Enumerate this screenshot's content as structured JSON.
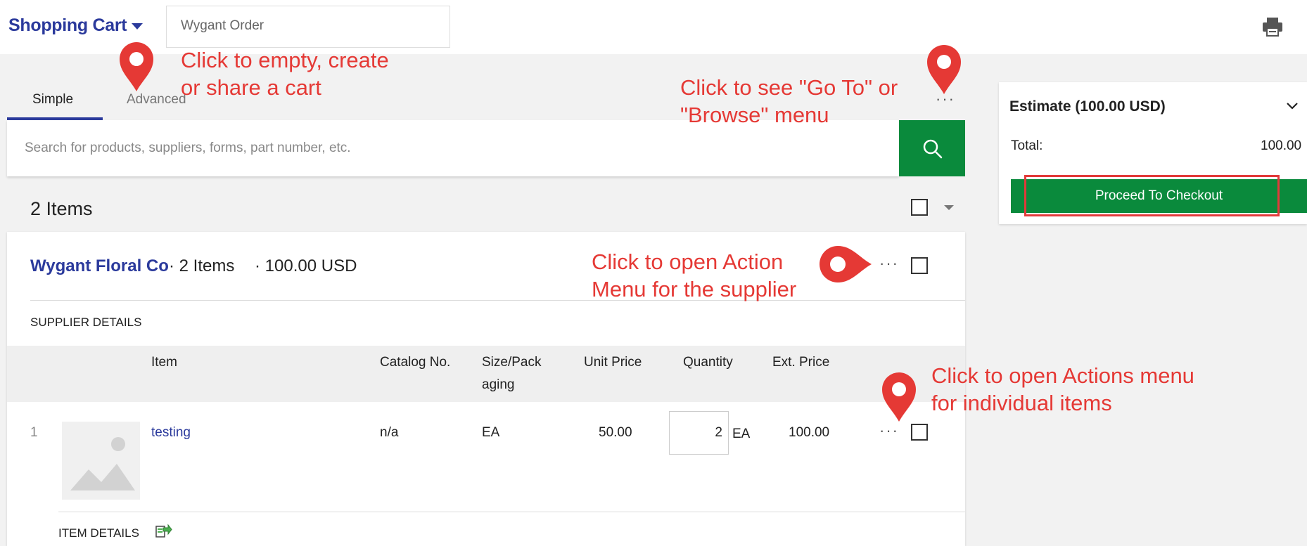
{
  "header": {
    "title": "Shopping Cart",
    "cart_name_value": "Wygant Order"
  },
  "tabs": [
    {
      "label": "Simple",
      "active": true
    },
    {
      "label": "Advanced",
      "active": false
    }
  ],
  "more_menu_glyph": "···",
  "search": {
    "placeholder": "Search for products, suppliers, forms, part number, etc."
  },
  "cart": {
    "items_count": "2 Items"
  },
  "supplier": {
    "name": "Wygant Floral Co",
    "items": "· 2 Items",
    "total": "· 100.00 USD",
    "details_label": "SUPPLIER DETAILS"
  },
  "table": {
    "headers": {
      "item": "Item",
      "catalog": "Catalog No.",
      "size": "Size/Pack aging",
      "unit_price": "Unit Price",
      "quantity": "Quantity",
      "ext_price": "Ext. Price"
    },
    "rows": [
      {
        "index": "1",
        "name": "testing",
        "catalog": "n/a",
        "size": "EA",
        "unit_price": "50.00",
        "quantity": "2",
        "uom": "EA",
        "ext_price": "100.00"
      }
    ],
    "item_details_label": "ITEM DETAILS"
  },
  "estimate": {
    "title": "Estimate (100.00 USD)",
    "total_label": "Total:",
    "total_value": "100.00",
    "checkout_label": "Proceed To Checkout"
  },
  "annotations": {
    "cart_menu": "Click to empty, create\nor share a cart",
    "more_menu": "Click to see \"Go To\" or\n\"Browse\" menu",
    "supplier_actions": "Click to open Action\nMenu for the supplier",
    "item_actions": "Click to open Actions menu\nfor individual items"
  },
  "colors": {
    "brand_blue": "#2b3a9c",
    "primary_green": "#0a8a3c",
    "annotation_red": "#e53935"
  },
  "icons": {
    "print": "printer-icon",
    "search": "search-icon",
    "cart_dropdown": "caret-down-icon",
    "estimate_toggle": "chevron-down-icon",
    "item_details": "export-icon",
    "pin": "map-pin-icon"
  }
}
